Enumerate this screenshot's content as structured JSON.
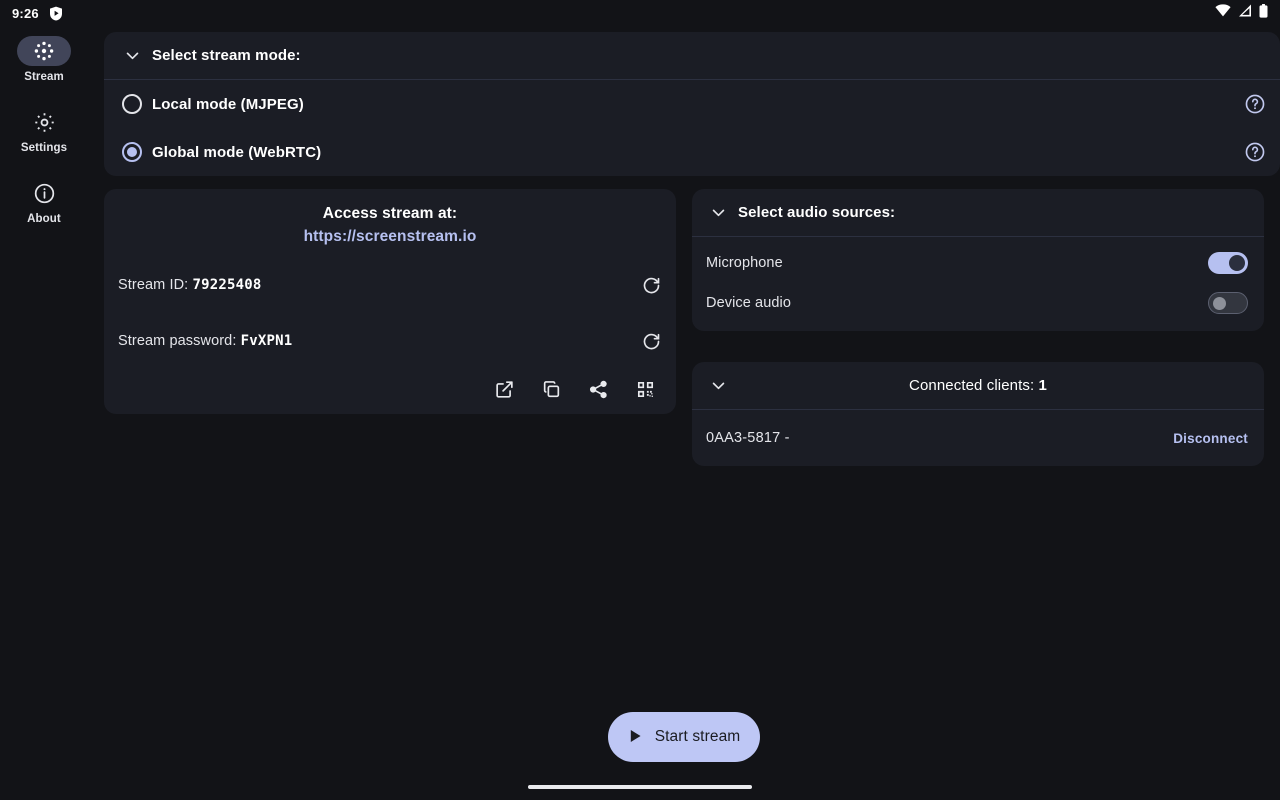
{
  "statusbar": {
    "time": "9:26",
    "shield_icon": "shield-play-icon",
    "wifi_icon": "wifi-icon",
    "signal_icon": "cellular-signal-icon",
    "battery_icon": "battery-full-icon"
  },
  "sidebar": {
    "items": [
      {
        "label": "Stream",
        "icon": "stream-burst-icon",
        "active": true
      },
      {
        "label": "Settings",
        "icon": "gear-icon",
        "active": false
      },
      {
        "label": "About",
        "icon": "info-circle-icon",
        "active": false
      }
    ]
  },
  "mode_card": {
    "header": "Select stream mode:",
    "chevron_icon": "chevron-down-icon",
    "options": [
      {
        "label": "Local mode (MJPEG)",
        "selected": false,
        "help_icon": "help-circle-icon"
      },
      {
        "label": "Global mode (WebRTC)",
        "selected": true,
        "help_icon": "help-circle-icon"
      }
    ]
  },
  "stream_card": {
    "access_title": "Access stream at:",
    "access_url": "https://screenstream.io",
    "stream_id_label": "Stream ID:",
    "stream_id_value": "79225408",
    "stream_password_label": "Stream password:",
    "stream_password_value": "FvXPN1",
    "refresh_icon": "refresh-icon",
    "actions": [
      {
        "name": "open-external-icon"
      },
      {
        "name": "copy-icon"
      },
      {
        "name": "share-icon"
      },
      {
        "name": "qr-code-icon"
      }
    ]
  },
  "audio_card": {
    "header": "Select audio sources:",
    "chevron_icon": "chevron-down-icon",
    "rows": [
      {
        "label": "Microphone",
        "on": true
      },
      {
        "label": "Device audio",
        "on": false
      }
    ]
  },
  "clients_card": {
    "title_prefix": "Connected clients: ",
    "count": "1",
    "chevron_icon": "chevron-down-icon",
    "rows": [
      {
        "id": "0AA3-5817  -",
        "action": "Disconnect"
      }
    ]
  },
  "start_button": {
    "label": "Start stream",
    "icon": "play-icon"
  },
  "colors": {
    "page_background": "#121317",
    "card_background": "#1b1d25",
    "accent": "#b6c0f0",
    "button_background": "#bec7f5",
    "divider": "#2c3040",
    "text_primary": "#ffffff",
    "text_secondary": "#e4e5ea"
  }
}
